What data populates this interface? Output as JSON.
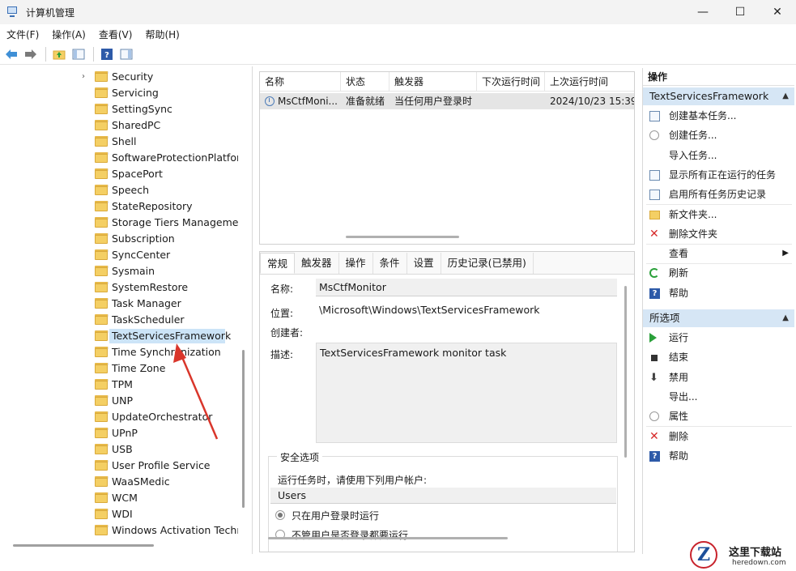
{
  "window": {
    "title": "计算机管理",
    "min": "—",
    "max": "☐",
    "close": "✕"
  },
  "menu": [
    "文件(F)",
    "操作(A)",
    "查看(V)",
    "帮助(H)"
  ],
  "tree": {
    "items": [
      {
        "label": "Security",
        "expander": "›"
      },
      {
        "label": "Servicing"
      },
      {
        "label": "SettingSync"
      },
      {
        "label": "SharedPC"
      },
      {
        "label": "Shell"
      },
      {
        "label": "SoftwareProtectionPlatform"
      },
      {
        "label": "SpacePort"
      },
      {
        "label": "Speech"
      },
      {
        "label": "StateRepository"
      },
      {
        "label": "Storage Tiers Management"
      },
      {
        "label": "Subscription"
      },
      {
        "label": "SyncCenter"
      },
      {
        "label": "Sysmain"
      },
      {
        "label": "SystemRestore"
      },
      {
        "label": "Task Manager"
      },
      {
        "label": "TaskScheduler"
      },
      {
        "label": "TextServicesFramework",
        "selected": true
      },
      {
        "label": "Time Synchronization"
      },
      {
        "label": "Time Zone"
      },
      {
        "label": "TPM"
      },
      {
        "label": "UNP"
      },
      {
        "label": "UpdateOrchestrator"
      },
      {
        "label": "UPnP"
      },
      {
        "label": "USB"
      },
      {
        "label": "User Profile Service"
      },
      {
        "label": "WaaSMedic"
      },
      {
        "label": "WCM"
      },
      {
        "label": "WDI"
      },
      {
        "label": "Windows Activation Technologies"
      }
    ]
  },
  "task_list": {
    "columns": [
      "名称",
      "状态",
      "触发器",
      "下次运行时间",
      "上次运行时间"
    ],
    "rows": [
      {
        "name": "MsCtfMoni...",
        "status": "准备就绪",
        "trigger": "当任何用户登录时",
        "next": "",
        "last": "2024/10/23 15:39:"
      }
    ]
  },
  "detail": {
    "tabs": [
      "常规",
      "触发器",
      "操作",
      "条件",
      "设置",
      "历史记录(已禁用)"
    ],
    "name_label": "名称:",
    "name_value": "MsCtfMonitor",
    "location_label": "位置:",
    "location_value": "\\Microsoft\\Windows\\TextServicesFramework",
    "author_label": "创建者:",
    "desc_label": "描述:",
    "desc_value": "TextServicesFramework monitor task",
    "security_title": "安全选项",
    "security_text": "运行任务时，请使用下列用户帐户:",
    "security_user": "Users",
    "radio1": "只在用户登录时运行",
    "radio2": "不管用户是否登录都要运行"
  },
  "actions": {
    "header": "操作",
    "section1": "TextServicesFramework",
    "items1": [
      {
        "label": "创建基本任务...",
        "icon": "create-basic-task-icon"
      },
      {
        "label": "创建任务...",
        "icon": "create-task-icon"
      },
      {
        "label": "导入任务...",
        "icon": ""
      },
      {
        "label": "显示所有正在运行的任务",
        "icon": "running-tasks-icon"
      },
      {
        "label": "启用所有任务历史记录",
        "icon": "history-icon"
      },
      {
        "label": "新文件夹...",
        "icon": "new-folder-icon"
      },
      {
        "label": "删除文件夹",
        "icon": "delete-icon"
      },
      {
        "label": "查看",
        "icon": "",
        "submenu": "▶"
      },
      {
        "label": "刷新",
        "icon": "refresh-icon"
      },
      {
        "label": "帮助",
        "icon": "help-icon"
      }
    ],
    "section2": "所选项",
    "items2": [
      {
        "label": "运行",
        "icon": "run-icon"
      },
      {
        "label": "结束",
        "icon": "stop-icon"
      },
      {
        "label": "禁用",
        "icon": "disable-icon"
      },
      {
        "label": "导出...",
        "icon": ""
      },
      {
        "label": "属性",
        "icon": "properties-icon"
      },
      {
        "label": "删除",
        "icon": "delete-icon"
      },
      {
        "label": "帮助",
        "icon": "help-icon"
      }
    ]
  },
  "watermark": {
    "logo": "Z",
    "title": "这里下载站",
    "sub": "heredown.com"
  },
  "colors": {
    "selection": "#cce4f7",
    "section_bg": "#d6e6f5",
    "annotation_arrow": "#d9362b"
  }
}
